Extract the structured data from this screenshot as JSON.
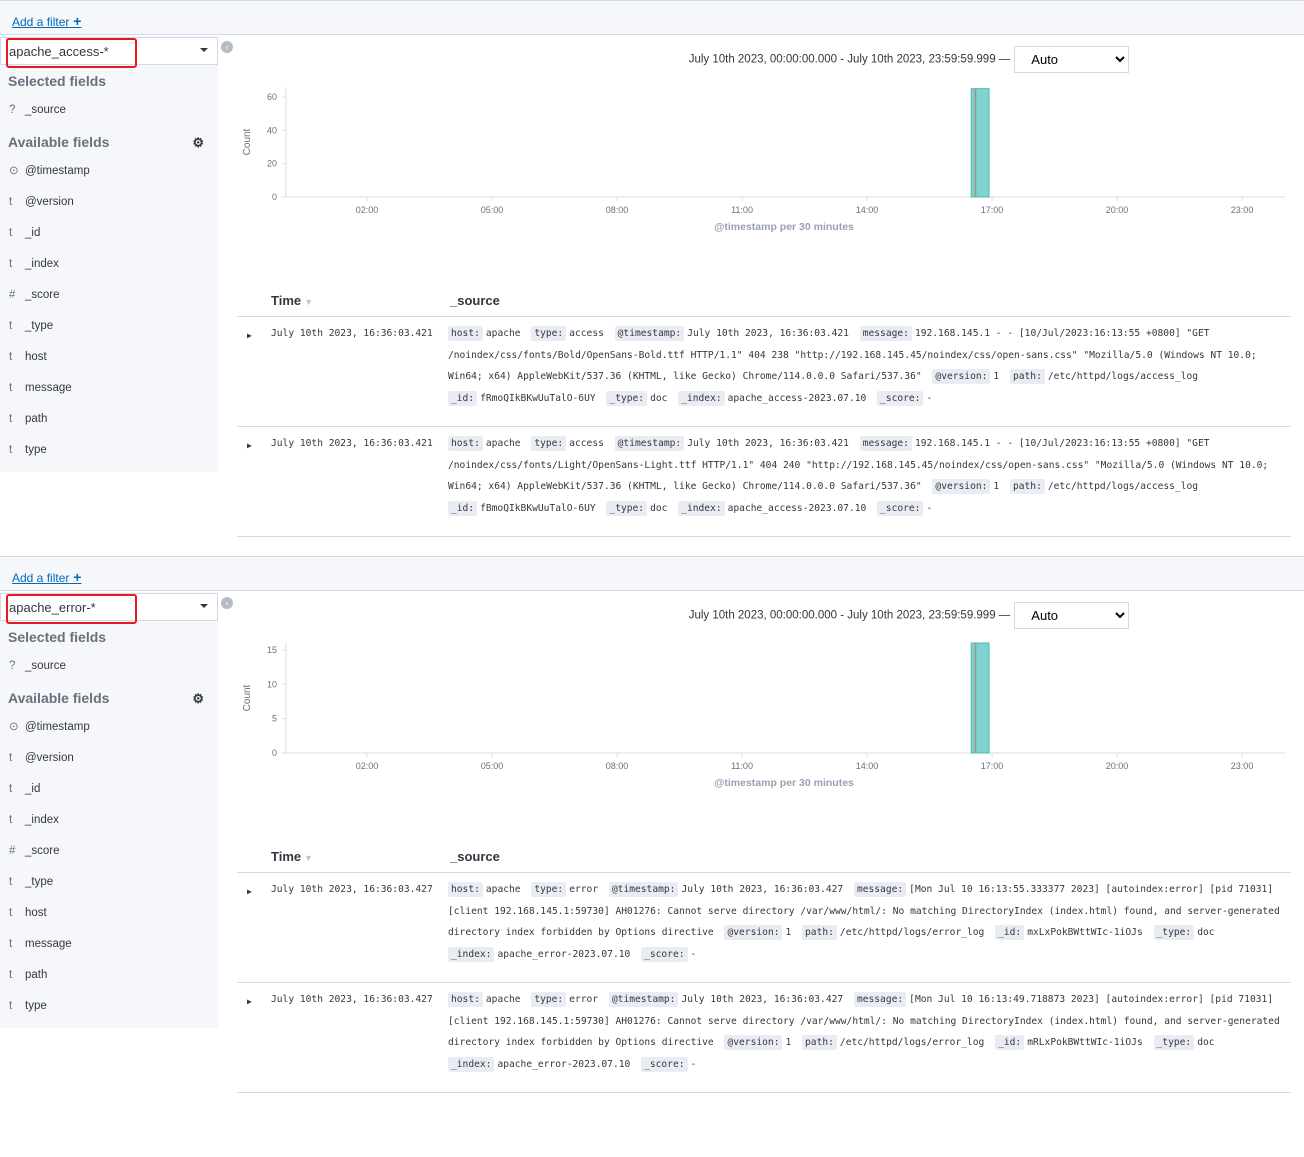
{
  "panels": [
    {
      "add_filter": "Add a filter",
      "index_pattern": "apache_access-*",
      "selected_fields_title": "Selected fields",
      "selected_fields": [
        {
          "type": "?",
          "name": "_source"
        }
      ],
      "available_fields_title": "Available fields",
      "available_fields": [
        {
          "type": "clock",
          "name": "@timestamp"
        },
        {
          "type": "t",
          "name": "@version"
        },
        {
          "type": "t",
          "name": "_id"
        },
        {
          "type": "t",
          "name": "_index"
        },
        {
          "type": "#",
          "name": "_score"
        },
        {
          "type": "t",
          "name": "_type"
        },
        {
          "type": "t",
          "name": "host"
        },
        {
          "type": "t",
          "name": "message"
        },
        {
          "type": "t",
          "name": "path"
        },
        {
          "type": "t",
          "name": "type"
        }
      ],
      "time_range": "July 10th 2023, 00:00:00.000 - July 10th 2023, 23:59:59.999 —",
      "interval": "Auto",
      "chart_data": {
        "type": "bar",
        "ylabel": "Count",
        "xlabel": "@timestamp per 30 minutes",
        "x_ticks": [
          "02:00",
          "05:00",
          "08:00",
          "11:00",
          "14:00",
          "17:00",
          "20:00",
          "23:00"
        ],
        "yticks": [
          0,
          20,
          40,
          60
        ],
        "ylim": [
          0,
          66
        ],
        "bars": [
          {
            "x": "16:30",
            "value": 65
          }
        ],
        "current_time_marker": "16:36",
        "bar_color": "#80d4cf"
      },
      "table": {
        "time_header": "Time",
        "source_header": "_source",
        "rows": [
          {
            "time": "July 10th 2023, 16:36:03.421",
            "source": [
              [
                "host:",
                "apache"
              ],
              [
                "type:",
                "access"
              ],
              [
                "@timestamp:",
                "July 10th 2023, 16:36:03.421"
              ],
              [
                "message:",
                "192.168.145.1 - - [10/Jul/2023:16:13:55 +0800] \"GET /noindex/css/fonts/Bold/OpenSans-Bold.ttf HTTP/1.1\" 404 238 \"http://192.168.145.45/noindex/css/open-sans.css\" \"Mozilla/5.0 (Windows NT 10.0; Win64; x64) AppleWebKit/537.36 (KHTML, like Gecko) Chrome/114.0.0.0 Safari/537.36\""
              ],
              [
                "@version:",
                "1"
              ],
              [
                "path:",
                "/etc/httpd/logs/access_log"
              ],
              [
                "_id:",
                "fRmoQIkBKwUuTalO-6UY"
              ],
              [
                "_type:",
                "doc"
              ],
              [
                "_index:",
                "apache_access-2023.07.10"
              ],
              [
                "_score:",
                "-"
              ]
            ]
          },
          {
            "time": "July 10th 2023, 16:36:03.421",
            "source": [
              [
                "host:",
                "apache"
              ],
              [
                "type:",
                "access"
              ],
              [
                "@timestamp:",
                "July 10th 2023, 16:36:03.421"
              ],
              [
                "message:",
                "192.168.145.1 - - [10/Jul/2023:16:13:55 +0800] \"GET /noindex/css/fonts/Light/OpenSans-Light.ttf HTTP/1.1\" 404 240 \"http://192.168.145.45/noindex/css/open-sans.css\" \"Mozilla/5.0 (Windows NT 10.0; Win64; x64) AppleWebKit/537.36 (KHTML, like Gecko) Chrome/114.0.0.0 Safari/537.36\""
              ],
              [
                "@version:",
                "1"
              ],
              [
                "path:",
                "/etc/httpd/logs/access_log"
              ],
              [
                "_id:",
                "fBmoQIkBKwUuTalO-6UY"
              ],
              [
                "_type:",
                "doc"
              ],
              [
                "_index:",
                "apache_access-2023.07.10"
              ],
              [
                "_score:",
                "-"
              ]
            ]
          }
        ]
      }
    },
    {
      "add_filter": "Add a filter",
      "index_pattern": "apache_error-*",
      "selected_fields_title": "Selected fields",
      "selected_fields": [
        {
          "type": "?",
          "name": "_source"
        }
      ],
      "available_fields_title": "Available fields",
      "available_fields": [
        {
          "type": "clock",
          "name": "@timestamp"
        },
        {
          "type": "t",
          "name": "@version"
        },
        {
          "type": "t",
          "name": "_id"
        },
        {
          "type": "t",
          "name": "_index"
        },
        {
          "type": "#",
          "name": "_score"
        },
        {
          "type": "t",
          "name": "_type"
        },
        {
          "type": "t",
          "name": "host"
        },
        {
          "type": "t",
          "name": "message"
        },
        {
          "type": "t",
          "name": "path"
        },
        {
          "type": "t",
          "name": "type"
        }
      ],
      "time_range": "July 10th 2023, 00:00:00.000 - July 10th 2023, 23:59:59.999 —",
      "interval": "Auto",
      "chart_data": {
        "type": "bar",
        "ylabel": "Count",
        "xlabel": "@timestamp per 30 minutes",
        "x_ticks": [
          "02:00",
          "05:00",
          "08:00",
          "11:00",
          "14:00",
          "17:00",
          "20:00",
          "23:00"
        ],
        "yticks": [
          0,
          5,
          10,
          15
        ],
        "ylim": [
          0,
          16
        ],
        "bars": [
          {
            "x": "16:30",
            "value": 16
          }
        ],
        "current_time_marker": "16:36",
        "bar_color": "#80d4cf"
      },
      "table": {
        "time_header": "Time",
        "source_header": "_source",
        "rows": [
          {
            "time": "July 10th 2023, 16:36:03.427",
            "source": [
              [
                "host:",
                "apache"
              ],
              [
                "type:",
                "error"
              ],
              [
                "@timestamp:",
                "July 10th 2023, 16:36:03.427"
              ],
              [
                "message:",
                "[Mon Jul 10 16:13:55.333377 2023] [autoindex:error] [pid 71031] [client 192.168.145.1:59730] AH01276: Cannot serve directory /var/www/html/: No matching DirectoryIndex (index.html) found, and server-generated directory index forbidden by Options directive"
              ],
              [
                "@version:",
                "1"
              ],
              [
                "path:",
                "/etc/httpd/logs/error_log"
              ],
              [
                "_id:",
                "mxLxPokBWttWIc-1iOJs"
              ],
              [
                "_type:",
                "doc"
              ],
              [
                "_index:",
                "apache_error-2023.07.10"
              ],
              [
                "_score:",
                "-"
              ]
            ]
          },
          {
            "time": "July 10th 2023, 16:36:03.427",
            "source": [
              [
                "host:",
                "apache"
              ],
              [
                "type:",
                "error"
              ],
              [
                "@timestamp:",
                "July 10th 2023, 16:36:03.427"
              ],
              [
                "message:",
                "[Mon Jul 10 16:13:49.718873 2023] [autoindex:error] [pid 71031] [client 192.168.145.1:59730] AH01276: Cannot serve directory /var/www/html/: No matching DirectoryIndex (index.html) found, and server-generated directory index forbidden by Options directive"
              ],
              [
                "@version:",
                "1"
              ],
              [
                "path:",
                "/etc/httpd/logs/error_log"
              ],
              [
                "_id:",
                "mRLxPokBWttWIc-1iOJs"
              ],
              [
                "_type:",
                "doc"
              ],
              [
                "_index:",
                "apache_error-2023.07.10"
              ],
              [
                "_score:",
                "-"
              ]
            ]
          }
        ]
      }
    }
  ]
}
